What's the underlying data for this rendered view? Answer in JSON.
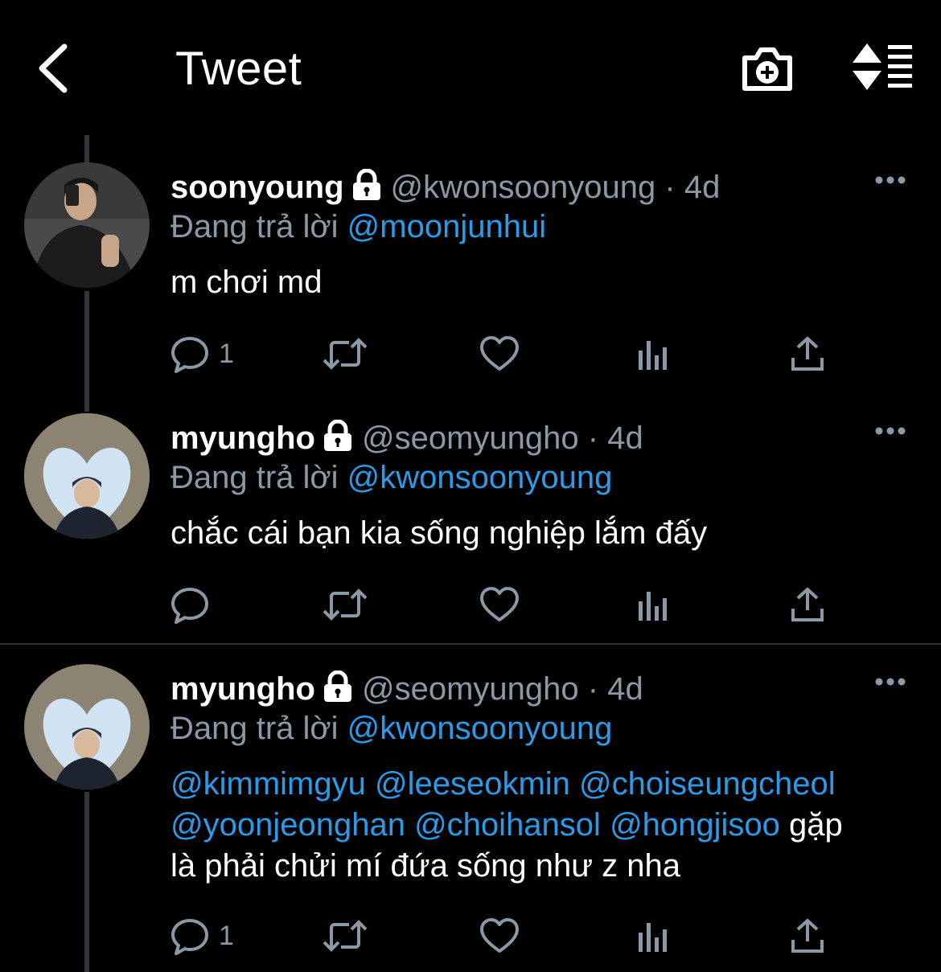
{
  "header": {
    "title": "Tweet",
    "back_icon": "chevron-left-icon",
    "camera_icon": "camera-add-icon",
    "sort_icon": "sort-icon"
  },
  "tweets": [
    {
      "name": "soonyoung",
      "handle": "@kwonsoonyoung",
      "sep": "·",
      "time": "4d",
      "reply_prefix": "Đang trả lời",
      "reply_to": "@moonjunhui",
      "text": "m chơi md",
      "reply_count": "1"
    },
    {
      "name": "myungho",
      "handle": "@seomyungho",
      "sep": "·",
      "time": "4d",
      "reply_prefix": "Đang trả lời",
      "reply_to": "@kwonsoonyoung",
      "text": "chắc cái bạn kia sống nghiệp lắm đấy",
      "reply_count": ""
    },
    {
      "name": "myungho",
      "handle": "@seomyungho",
      "sep": "·",
      "time": "4d",
      "reply_prefix": "Đang trả lời",
      "reply_to": "@kwonsoonyoung",
      "line1_mentions": [
        "@kimmimgyu",
        "@leeseokmin",
        "@choiseungcheol"
      ],
      "line2_mentions": [
        "@yoonjeonghan",
        "@choihansol",
        "@hongjisoo"
      ],
      "line2_text": "gặp",
      "line3_text": "là phải chửi mí đứa sống như z nha",
      "reply_count": "1"
    }
  ],
  "colors": {
    "background": "#000000",
    "mention": "#2b9be8",
    "secondary": "#8b98a5",
    "primary": "#ffffff"
  }
}
